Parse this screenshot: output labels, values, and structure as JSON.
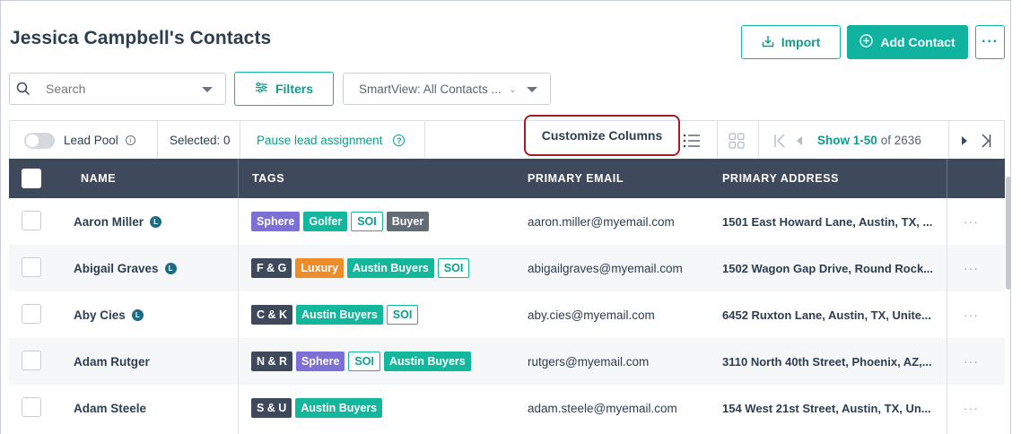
{
  "header": {
    "title": "Jessica Campbell's Contacts",
    "import_label": "Import",
    "add_contact_label": "Add Contact",
    "more_label": "···"
  },
  "search": {
    "placeholder": "Search"
  },
  "filters": {
    "filters_label": "Filters",
    "smartview_label": "SmartView: All Contacts ..."
  },
  "toolbar": {
    "lead_pool_label": "Lead Pool",
    "selected_label": "Selected: 0",
    "pause_label": "Pause lead assignment",
    "customize_label": "Customize Columns",
    "pager_show": "Show 1-50",
    "pager_total": "of 2636"
  },
  "table": {
    "columns": [
      "NAME",
      "TAGS",
      "PRIMARY EMAIL",
      "PRIMARY ADDRESS"
    ],
    "rows": [
      {
        "name": "Aaron Miller",
        "lead_badge": true,
        "tags": [
          {
            "label": "Sphere",
            "style": "purple"
          },
          {
            "label": "Golfer",
            "style": "teal"
          },
          {
            "label": "SOI",
            "style": "outline"
          },
          {
            "label": "Buyer",
            "style": "gray"
          }
        ],
        "email": "aaron.miller@myemail.com",
        "address": "1501 East Howard Lane, Austin, TX, ..."
      },
      {
        "name": "Abigail Graves",
        "lead_badge": true,
        "tags": [
          {
            "label": "F & G",
            "style": "dark"
          },
          {
            "label": "Luxury",
            "style": "orange"
          },
          {
            "label": "Austin Buyers",
            "style": "teal"
          },
          {
            "label": "SOI",
            "style": "outline"
          }
        ],
        "email": "abigailgraves@myemail.com",
        "address": "1502 Wagon Gap Drive, Round Rock..."
      },
      {
        "name": "Aby Cies",
        "lead_badge": true,
        "tags": [
          {
            "label": "C & K",
            "style": "dark"
          },
          {
            "label": "Austin Buyers",
            "style": "teal"
          },
          {
            "label": "SOI",
            "style": "outline"
          }
        ],
        "email": "aby.cies@myemail.com",
        "address": "6452 Ruxton Lane, Austin, TX, Unite..."
      },
      {
        "name": "Adam Rutger",
        "lead_badge": false,
        "tags": [
          {
            "label": "N & R",
            "style": "dark"
          },
          {
            "label": "Sphere",
            "style": "purple"
          },
          {
            "label": "SOI",
            "style": "outline"
          },
          {
            "label": "Austin Buyers",
            "style": "teal"
          }
        ],
        "email": "rutgers@myemail.com",
        "address": "3110 North 40th Street, Phoenix, AZ,..."
      },
      {
        "name": "Adam Steele",
        "lead_badge": false,
        "tags": [
          {
            "label": "S & U",
            "style": "dark"
          },
          {
            "label": "Austin Buyers",
            "style": "teal"
          }
        ],
        "email": "adam.steele@myemail.com",
        "address": "154 West 21st Street, Austin, TX, Un..."
      }
    ]
  },
  "colors": {
    "accent": "#10b2a0",
    "header_bg": "#3e4a5c",
    "highlight": "#a31d24"
  }
}
